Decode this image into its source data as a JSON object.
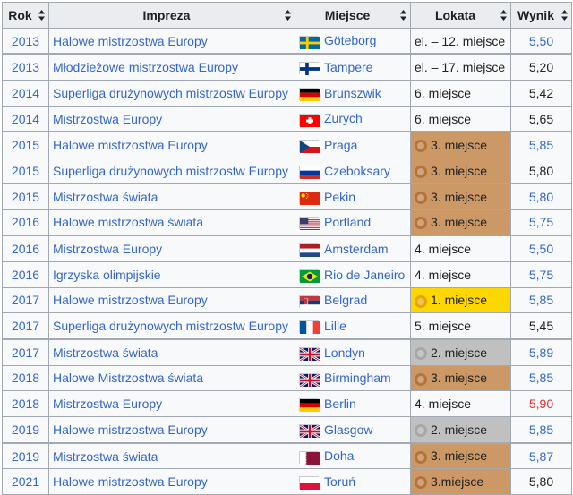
{
  "headers": [
    "Rok",
    "Impreza",
    "Miejsce",
    "Lokata",
    "Wynik"
  ],
  "rows": [
    {
      "year": "2013",
      "event": "Halowe mistrzostwa Europy",
      "flag": "sweden",
      "city": "Göteborg",
      "place": "el. – 12. miejsce",
      "medal": "",
      "result": "5,50",
      "result_color": "blue"
    },
    {
      "year": "2013",
      "event": "Młodzieżowe mistrzostwa Europy",
      "flag": "finland",
      "city": "Tampere",
      "place": "el. – 17. miejsce",
      "medal": "",
      "result": "5,20",
      "result_color": "black"
    },
    {
      "year": "2014",
      "event": "Superliga drużynowych mistrzostw Europy",
      "flag": "germany",
      "city": "Brunszwik",
      "place": "6. miejsce",
      "medal": "",
      "result": "5,42",
      "result_color": "black"
    },
    {
      "year": "2014",
      "event": "Mistrzostwa Europy",
      "flag": "switzerland",
      "city": "Zurych",
      "place": "6. miejsce",
      "medal": "",
      "result": "5,65",
      "result_color": "black"
    },
    {
      "year": "2015",
      "event": "Halowe mistrzostwa Europy",
      "flag": "czechia",
      "city": "Praga",
      "place": "3. miejsce",
      "medal": "bronze",
      "result": "5,85",
      "result_color": "blue"
    },
    {
      "year": "2015",
      "event": "Superliga drużynowych mistrzostw Europy",
      "flag": "russia",
      "city": "Czeboksary",
      "place": "3. miejsce",
      "medal": "bronze",
      "result": "5,80",
      "result_color": "black"
    },
    {
      "year": "2015",
      "event": "Mistrzostwa świata",
      "flag": "china",
      "city": "Pekin",
      "place": "3. miejsce",
      "medal": "bronze",
      "result": "5,80",
      "result_color": "blue"
    },
    {
      "year": "2016",
      "event": "Halowe mistrzostwa świata",
      "flag": "usa",
      "city": "Portland",
      "place": "3. miejsce",
      "medal": "bronze",
      "result": "5,75",
      "result_color": "blue"
    },
    {
      "year": "2016",
      "event": "Mistrzostwa Europy",
      "flag": "netherlands",
      "city": "Amsterdam",
      "place": "4. miejsce",
      "medal": "",
      "result": "5,50",
      "result_color": "blue"
    },
    {
      "year": "2016",
      "event": "Igrzyska olimpijskie",
      "flag": "brazil",
      "city": "Rio de Janeiro",
      "place": "4. miejsce",
      "medal": "",
      "result": "5,75",
      "result_color": "blue"
    },
    {
      "year": "2017",
      "event": "Halowe mistrzostwa Europy",
      "flag": "serbia",
      "city": "Belgrad",
      "place": "1. miejsce",
      "medal": "gold",
      "result": "5,85",
      "result_color": "blue"
    },
    {
      "year": "2017",
      "event": "Superliga drużynowych mistrzostw Europy",
      "flag": "france",
      "city": "Lille",
      "place": "5. miejsce",
      "medal": "",
      "result": "5,45",
      "result_color": "black"
    },
    {
      "year": "2017",
      "event": "Mistrzostwa świata",
      "flag": "uk",
      "city": "Londyn",
      "place": "2. miejsce",
      "medal": "silver",
      "result": "5,89",
      "result_color": "blue"
    },
    {
      "year": "2018",
      "event": "Halowe Mistrzostwa świata",
      "flag": "uk",
      "city": "Birmingham",
      "place": "3. miejsce",
      "medal": "bronze",
      "result": "5,85",
      "result_color": "blue"
    },
    {
      "year": "2018",
      "event": "Mistrzostwa Europy",
      "flag": "germany",
      "city": "Berlin",
      "place": "4. miejsce",
      "medal": "",
      "result": "5,90",
      "result_color": "red"
    },
    {
      "year": "2019",
      "event": "Halowe mistrzostwa Europy",
      "flag": "uk",
      "city": "Glasgow",
      "place": "2. miejsce",
      "medal": "silver",
      "result": "5,85",
      "result_color": "blue"
    },
    {
      "year": "2019",
      "event": "Mistrzostwa świata",
      "flag": "qatar",
      "city": "Doha",
      "place": "3. miejsce",
      "medal": "bronze",
      "result": "5,87",
      "result_color": "blue"
    },
    {
      "year": "2021",
      "event": "Halowe mistrzostwa Europy",
      "flag": "poland",
      "city": "Toruń",
      "place": "3.miejsce",
      "medal": "bronze",
      "result": "5,80",
      "result_color": "black"
    }
  ],
  "colors": {
    "link": "#3366cc",
    "record_red": "#dd3333",
    "gold_cell": "#ffd700",
    "silver_cell": "#c0c0c0",
    "bronze_cell": "#cc9966",
    "header_bg": "#eaecf0",
    "cell_bg": "#f8f9fa",
    "border": "#a2a9b1"
  }
}
